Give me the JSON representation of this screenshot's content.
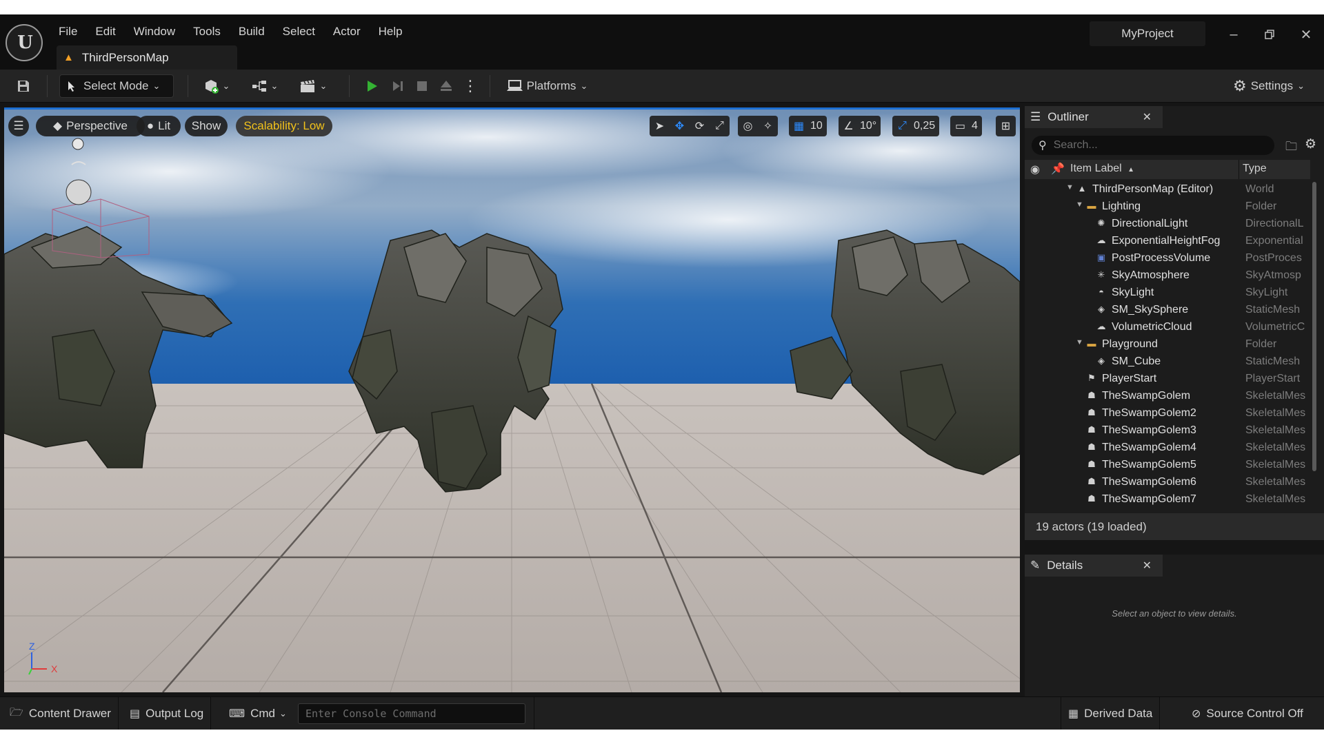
{
  "menu": [
    "File",
    "Edit",
    "Window",
    "Tools",
    "Build",
    "Select",
    "Actor",
    "Help"
  ],
  "map_tab": "ThirdPersonMap",
  "project_name": "MyProject",
  "toolbar": {
    "select_mode": "Select Mode",
    "platforms": "Platforms",
    "settings": "Settings"
  },
  "viewport": {
    "menu_icon": "hamburger-icon",
    "perspective": "Perspective",
    "lit": "Lit",
    "show": "Show",
    "scalability": "Scalability: Low",
    "grid_snap": "10",
    "rotation_snap": "10°",
    "scale_snap": "0,25",
    "camera_speed": "4",
    "axis_z": "Z",
    "axis_x": "X"
  },
  "outliner": {
    "title": "Outliner",
    "search_placeholder": "Search...",
    "col_label": "Item Label",
    "col_type": "Type",
    "sort_indicator": "▲",
    "rows": [
      {
        "label": "ThirdPersonMap (Editor)",
        "type": "World",
        "icon": "map-icon",
        "depth": 0,
        "expanded": true
      },
      {
        "label": "Lighting",
        "type": "Folder",
        "icon": "folder-icon",
        "depth": 1,
        "expanded": true
      },
      {
        "label": "DirectionalLight",
        "type": "DirectionalL",
        "icon": "sun-icon",
        "depth": 2
      },
      {
        "label": "ExponentialHeightFog",
        "type": "Exponential",
        "icon": "fog-icon",
        "depth": 2
      },
      {
        "label": "PostProcessVolume",
        "type": "PostProces",
        "icon": "volume-icon",
        "depth": 2
      },
      {
        "label": "SkyAtmosphere",
        "type": "SkyAtmosp",
        "icon": "atmosphere-icon",
        "depth": 2
      },
      {
        "label": "SkyLight",
        "type": "SkyLight",
        "icon": "skylight-icon",
        "depth": 2
      },
      {
        "label": "SM_SkySphere",
        "type": "StaticMesh",
        "icon": "mesh-icon",
        "depth": 2
      },
      {
        "label": "VolumetricCloud",
        "type": "VolumetricC",
        "icon": "cloud-icon",
        "depth": 2
      },
      {
        "label": "Playground",
        "type": "Folder",
        "icon": "folder-icon",
        "depth": 1,
        "expanded": true
      },
      {
        "label": "SM_Cube",
        "type": "StaticMesh",
        "icon": "mesh-icon",
        "depth": 2
      },
      {
        "label": "PlayerStart",
        "type": "PlayerStart",
        "icon": "player-start-icon",
        "depth": 1
      },
      {
        "label": "TheSwampGolem",
        "type": "SkeletalMes",
        "icon": "skeleton-icon",
        "depth": 1
      },
      {
        "label": "TheSwampGolem2",
        "type": "SkeletalMes",
        "icon": "skeleton-icon",
        "depth": 1
      },
      {
        "label": "TheSwampGolem3",
        "type": "SkeletalMes",
        "icon": "skeleton-icon",
        "depth": 1
      },
      {
        "label": "TheSwampGolem4",
        "type": "SkeletalMes",
        "icon": "skeleton-icon",
        "depth": 1
      },
      {
        "label": "TheSwampGolem5",
        "type": "SkeletalMes",
        "icon": "skeleton-icon",
        "depth": 1
      },
      {
        "label": "TheSwampGolem6",
        "type": "SkeletalMes",
        "icon": "skeleton-icon",
        "depth": 1
      },
      {
        "label": "TheSwampGolem7",
        "type": "SkeletalMes",
        "icon": "skeleton-icon",
        "depth": 1
      }
    ],
    "actor_count": "19 actors (19 loaded)"
  },
  "details": {
    "title": "Details",
    "empty_message": "Select an object to view details."
  },
  "statusbar": {
    "content_drawer": "Content Drawer",
    "output_log": "Output Log",
    "cmd": "Cmd",
    "console_placeholder": "Enter Console Command",
    "derived_data": "Derived Data",
    "source_control": "Source Control Off"
  },
  "colors": {
    "accent_blue": "#1d6fd2",
    "play_green": "#34b233",
    "scalability_yellow": "#f2c21b",
    "map_tab_orange": "#f29f25"
  }
}
